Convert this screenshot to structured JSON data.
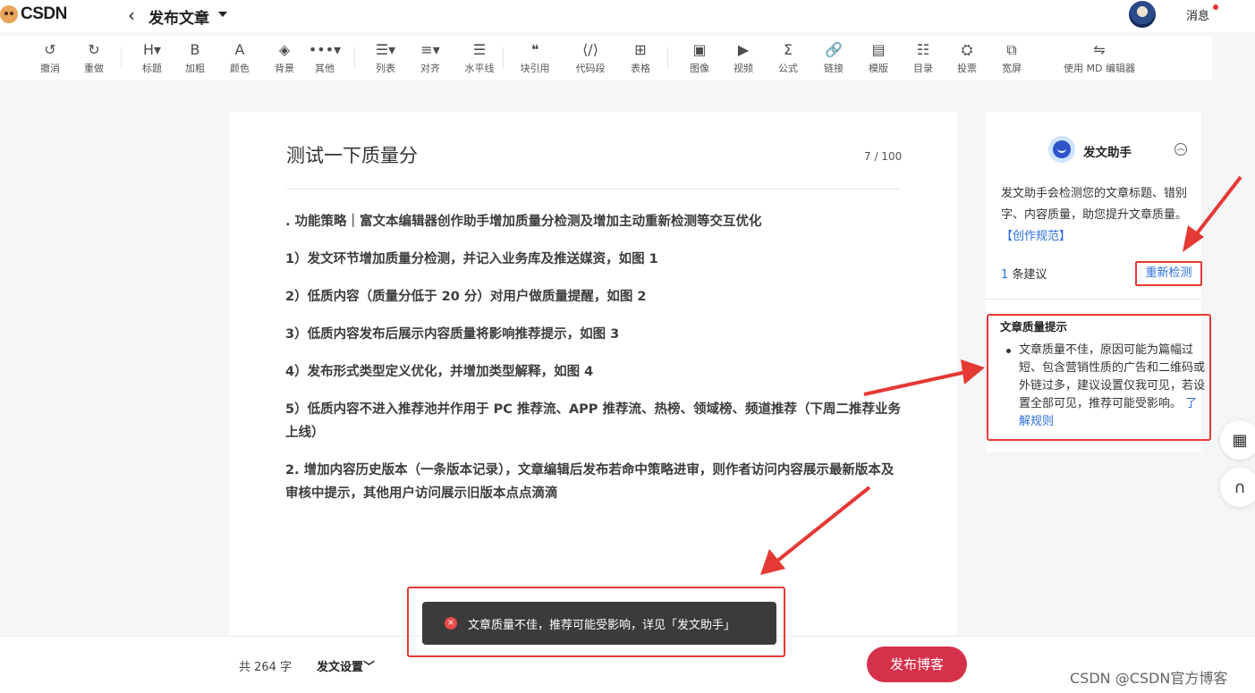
{
  "header": {
    "logo_text": "CSDN",
    "back_icon": "chevron-left-icon",
    "title": "发布文章",
    "message_label": "消息"
  },
  "toolbar": {
    "items": [
      {
        "icon": "↺",
        "label": "撤消"
      },
      {
        "icon": "↻",
        "label": "重做"
      },
      {
        "icon": "H▾",
        "label": "标题"
      },
      {
        "icon": "B",
        "label": "加粗"
      },
      {
        "icon": "A",
        "label": "颜色"
      },
      {
        "icon": "◈",
        "label": "背景"
      },
      {
        "icon": "•••▾",
        "label": "其他"
      },
      {
        "icon": "☰▾",
        "label": "列表"
      },
      {
        "icon": "≡▾",
        "label": "对齐"
      },
      {
        "icon": "☰",
        "label": "水平线"
      },
      {
        "icon": "❝",
        "label": "块引用"
      },
      {
        "icon": "⟨/⟩",
        "label": "代码段"
      },
      {
        "icon": "⊞",
        "label": "表格"
      },
      {
        "icon": "▣",
        "label": "图像"
      },
      {
        "icon": "▶",
        "label": "视频"
      },
      {
        "icon": "Σ",
        "label": "公式"
      },
      {
        "icon": "🔗",
        "label": "链接"
      },
      {
        "icon": "▤",
        "label": "模版"
      },
      {
        "icon": "☷",
        "label": "目录"
      },
      {
        "icon": "⛭",
        "label": "投票"
      },
      {
        "icon": "⧉",
        "label": "宽屏"
      },
      {
        "icon": "⇋",
        "label": "使用 MD 编辑器"
      }
    ]
  },
  "article": {
    "title": "测试一下质量分",
    "counter": "7 / 100",
    "paragraphs": [
      ". 功能策略｜富文本编辑器创作助手增加质量分检测及增加主动重新检测等交互优化",
      "1）发文环节增加质量分检测，并记入业务库及推送媒资，如图 1",
      "2）低质内容（质量分低于 20 分）对用户做质量提醒，如图 2",
      "3）低质内容发布后展示内容质量将影响推荐提示，如图 3",
      "4）发布形式类型定义优化，并增加类型解释，如图 4",
      "5）低质内容不进入推荐池并作用于 PC 推荐流、APP 推荐流、热榜、领域榜、频道推荐（下周二推荐业务上线）",
      "2. 增加内容历史版本（一条版本记录），文章编辑后发布若命中策略进审，则作者访问内容展示最新版本及审核中提示，其他用户访问展示旧版本点点滴滴"
    ]
  },
  "assistant": {
    "title": "发文助手",
    "desc": "发文助手会检测您的文章标题、错别字、内容质量，助您提升文章质量。",
    "desc_link": "【创作规范】",
    "count_num": "1",
    "count_text": " 条建议",
    "recheck": "重新检测",
    "tips_title": "文章质量提示",
    "tip": "文章质量不佳，原因可能为篇幅过短、包含营销性质的广告和二维码或外链过多，建议设置仅我可见，若设置全部可见，推荐可能受影响。",
    "tip_link": "了解规则"
  },
  "bottom": {
    "wordcount": "共 264 字",
    "settings": "发文设置",
    "publish": "发布博客",
    "watermark": "CSDN @CSDN官方博客"
  },
  "toast": {
    "icon": "×",
    "text": "文章质量不佳，推荐可能受影响，详见「发文助手」"
  },
  "colors": {
    "accent_blue": "#2a6fdb",
    "publish_red": "#d6314b",
    "annotation_red": "#e53935"
  }
}
